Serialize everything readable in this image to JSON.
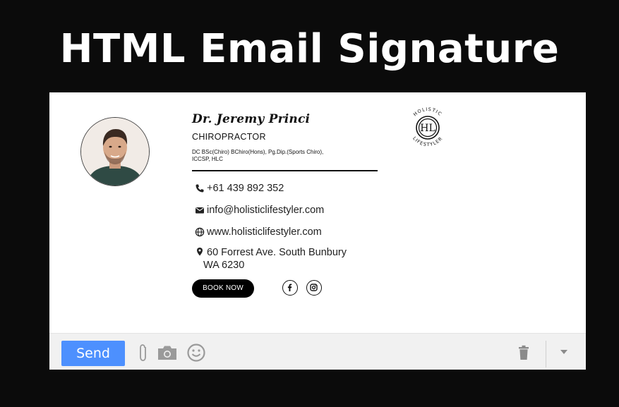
{
  "headline": "HTML Email Signature",
  "signature": {
    "name": "Dr. Jeremy Princi",
    "role": "CHIROPRACTOR",
    "qualifications": "DC BSc(Chiro) BChiro(Hons), Pg.Dip.(Sports Chiro), ICCSP, HLC",
    "phone": "+61 439 892 352",
    "email": "info@holisticlifestyler.com",
    "website": "www.holisticlifestyler.com",
    "address_line1": "60 Forrest Ave. South Bunbury",
    "address_line2": "WA 6230",
    "book_button": "BOOK NOW",
    "social_icons": [
      "facebook-icon",
      "instagram-icon"
    ],
    "logo": {
      "monogram": "HL",
      "top_text": "HOLISTIC",
      "bottom_text": "LIFESTYLER"
    }
  },
  "toolbar": {
    "send_label": "Send",
    "icons": [
      "paperclip-icon",
      "camera-icon",
      "smiley-icon",
      "trash-icon",
      "dropdown-arrow-icon"
    ]
  },
  "colors": {
    "background": "#0b0b0b",
    "send_button": "#4d90fe",
    "toolbar": "#f1f1f1"
  }
}
